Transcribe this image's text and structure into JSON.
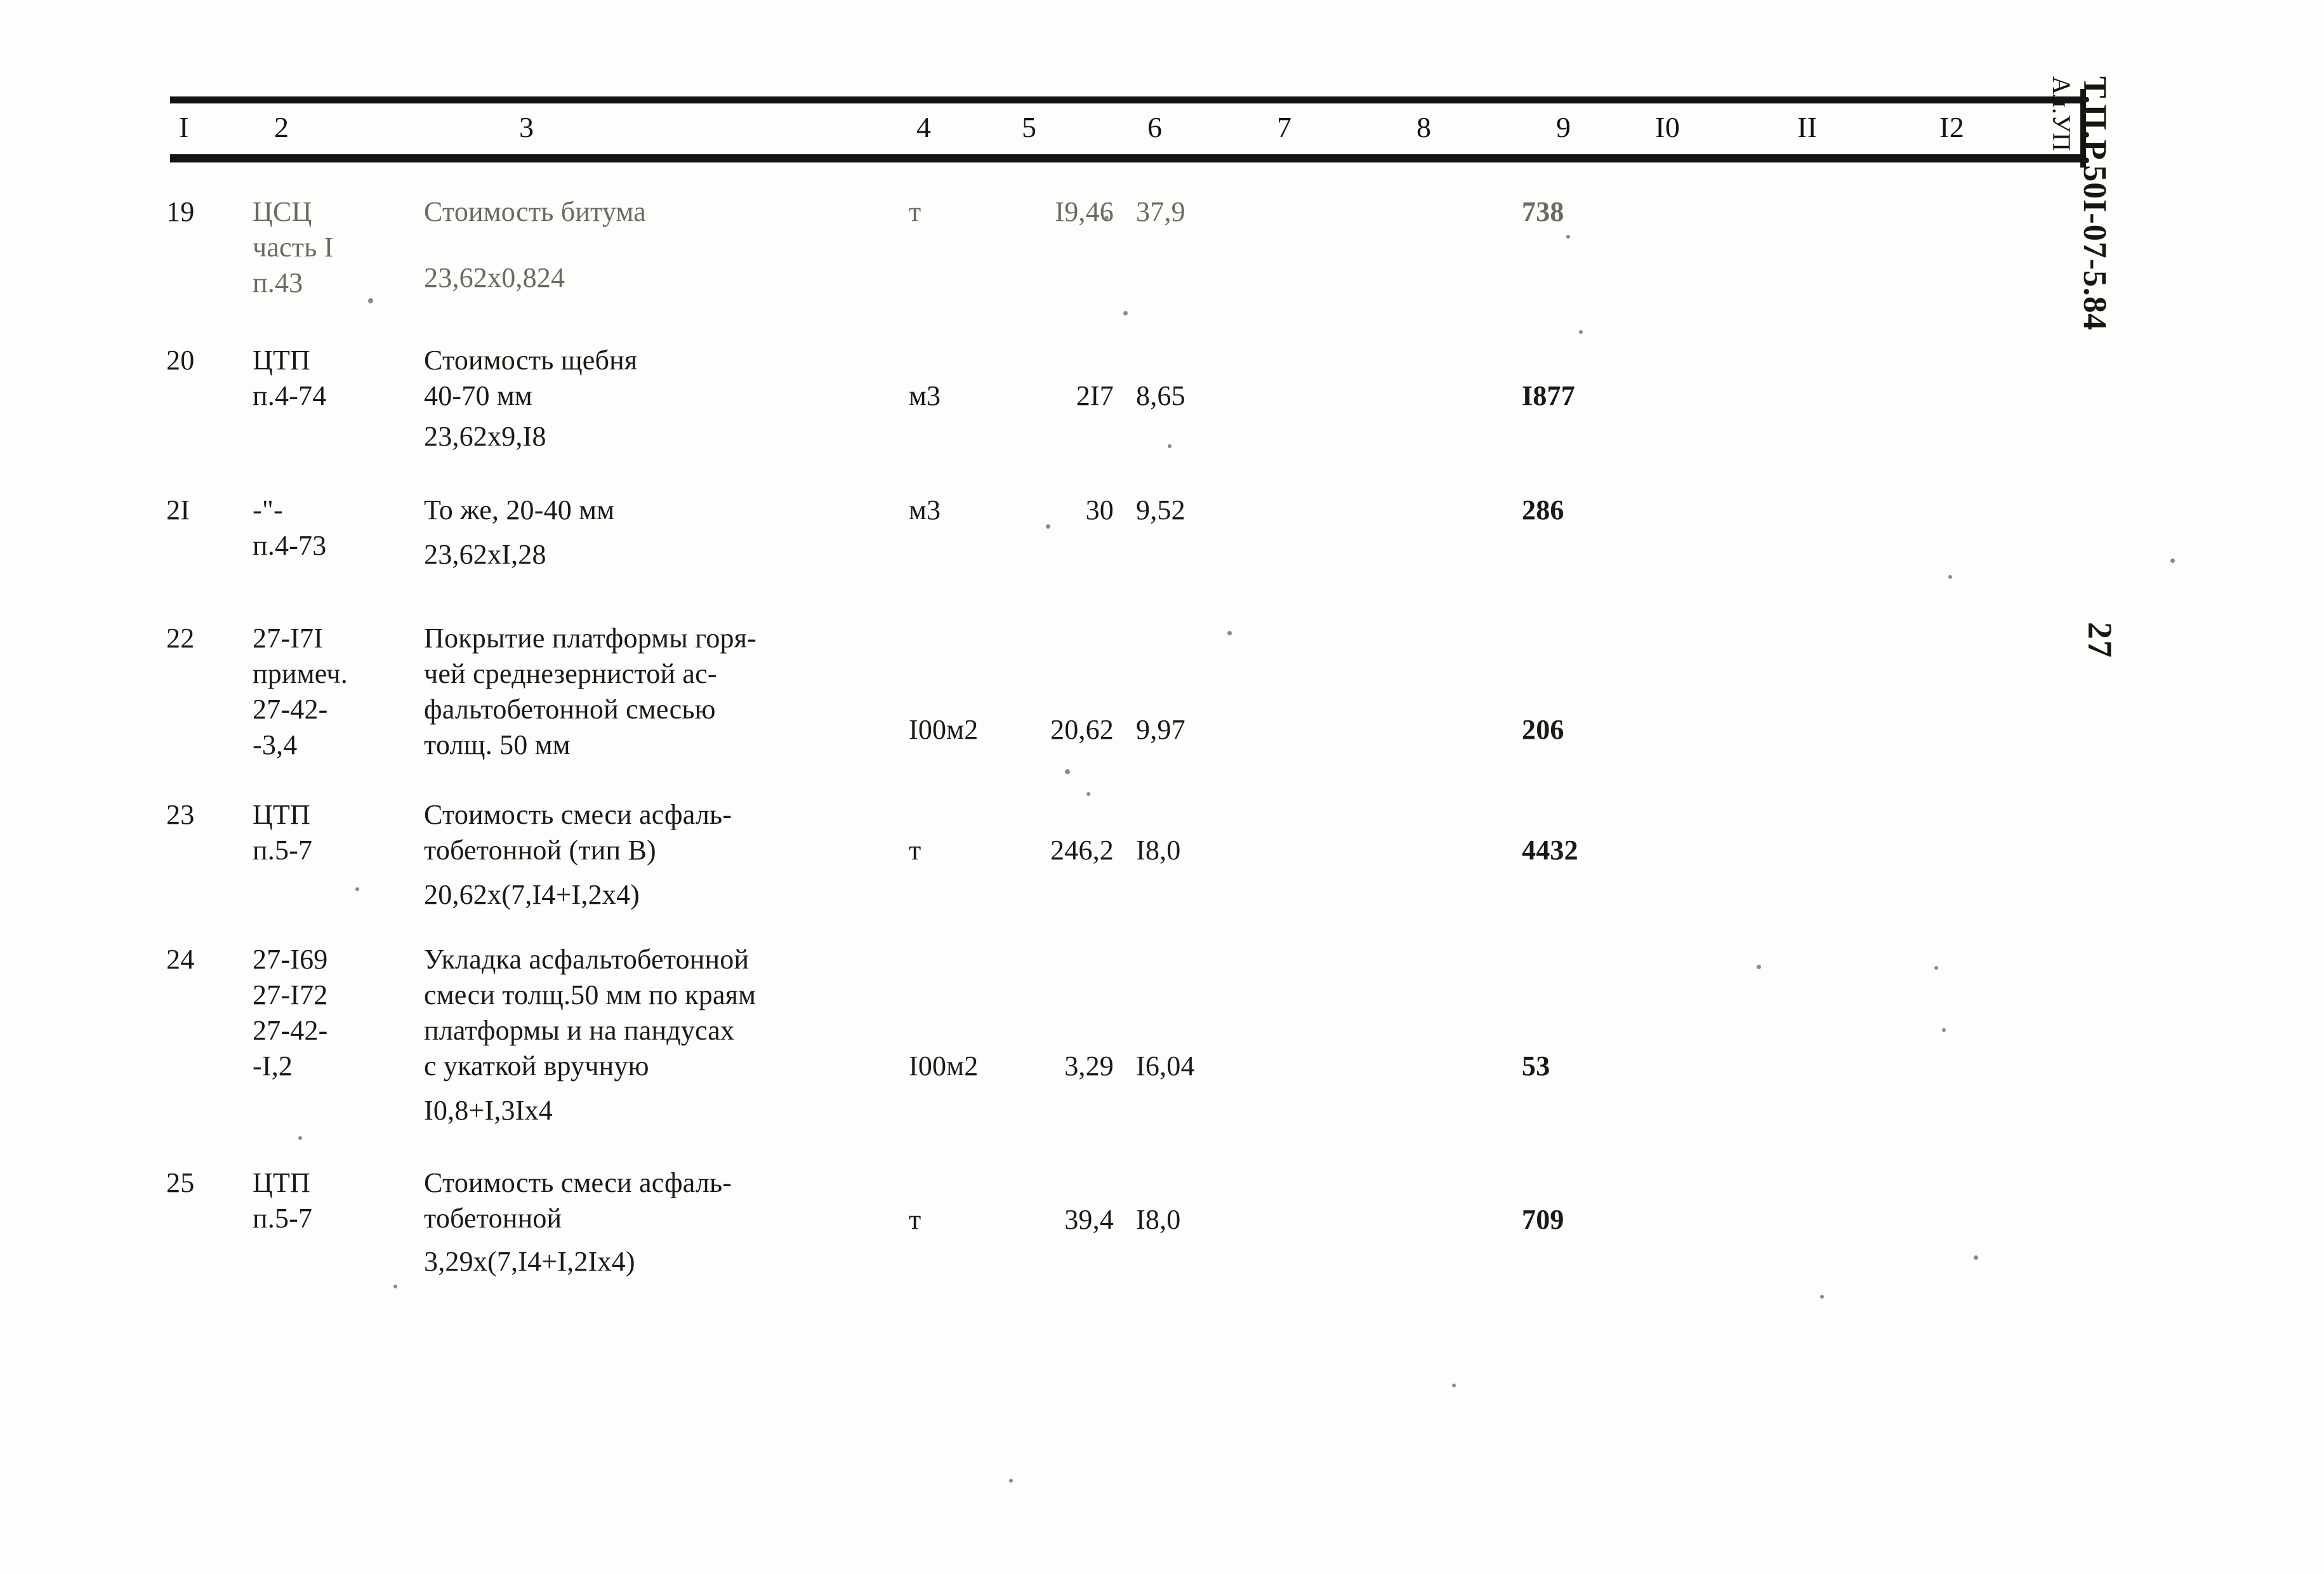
{
  "document": {
    "margin_code": "Т.П.Р.50I-07-5.84",
    "margin_album": "Ал.УП",
    "page_number": "27"
  },
  "table": {
    "column_headers": [
      "I",
      "2",
      "3",
      "4",
      "5",
      "6",
      "7",
      "8",
      "9",
      "I0",
      "II",
      "I2"
    ],
    "rows": [
      {
        "num": "19",
        "code": "ЦСЦ\nчасть I\nп.43",
        "desc": "Стоимость битума",
        "formula": "23,62х0,824",
        "unit": "т",
        "qty": "I9,46",
        "price": "37,9",
        "col7": "",
        "col8": "",
        "total": "738",
        "col10": "",
        "col11": "",
        "col12": ""
      },
      {
        "num": "20",
        "code": "ЦТП\nп.4-74",
        "desc": "Стоимость щебня\n40-70 мм",
        "formula": "23,62х9,I8",
        "unit": "м3",
        "qty": "2I7",
        "price": "8,65",
        "col7": "",
        "col8": "",
        "total": "I877",
        "col10": "",
        "col11": "",
        "col12": ""
      },
      {
        "num": "2I",
        "code": "-\"-\nп.4-73",
        "desc": "То же, 20-40 мм",
        "formula": "23,62хI,28",
        "unit": "м3",
        "qty": "30",
        "price": "9,52",
        "col7": "",
        "col8": "",
        "total": "286",
        "col10": "",
        "col11": "",
        "col12": ""
      },
      {
        "num": "22",
        "code": "27-I7I\nпримеч.\n27-42-\n-3,4",
        "desc": "Покрытие платформы горя-\nчей среднезернистой ас-\nфальтобетонной смесью\nтолщ. 50 мм",
        "formula": "",
        "unit": "I00м2",
        "qty": "20,62",
        "price": "9,97",
        "col7": "",
        "col8": "",
        "total": "206",
        "col10": "",
        "col11": "",
        "col12": ""
      },
      {
        "num": "23",
        "code": "ЦТП\nп.5-7",
        "desc": "Стоимость смеси асфаль-\nтобетонной (тип В)",
        "formula": "20,62х(7,I4+I,2х4)",
        "unit": "т",
        "qty": "246,2",
        "price": "I8,0",
        "col7": "",
        "col8": "",
        "total": "4432",
        "col10": "",
        "col11": "",
        "col12": ""
      },
      {
        "num": "24",
        "code": "27-I69\n27-I72\n27-42-\n-I,2",
        "desc": "Укладка асфальтобетонной\nсмеси толщ.50 мм по краям\nплатформы и на пандусах\nс укаткой вручную",
        "formula": "I0,8+I,3Iх4",
        "unit": "I00м2",
        "qty": "3,29",
        "price": "I6,04",
        "col7": "",
        "col8": "",
        "total": "53",
        "col10": "",
        "col11": "",
        "col12": ""
      },
      {
        "num": "25",
        "code": "ЦТП\nп.5-7",
        "desc": "Стоимость смеси асфаль-\nтобетонной",
        "formula": "3,29х(7,I4+I,2Iх4)",
        "unit": "т",
        "qty": "39,4",
        "price": "I8,0",
        "col7": "",
        "col8": "",
        "total": "709",
        "col10": "",
        "col11": "",
        "col12": ""
      }
    ]
  }
}
